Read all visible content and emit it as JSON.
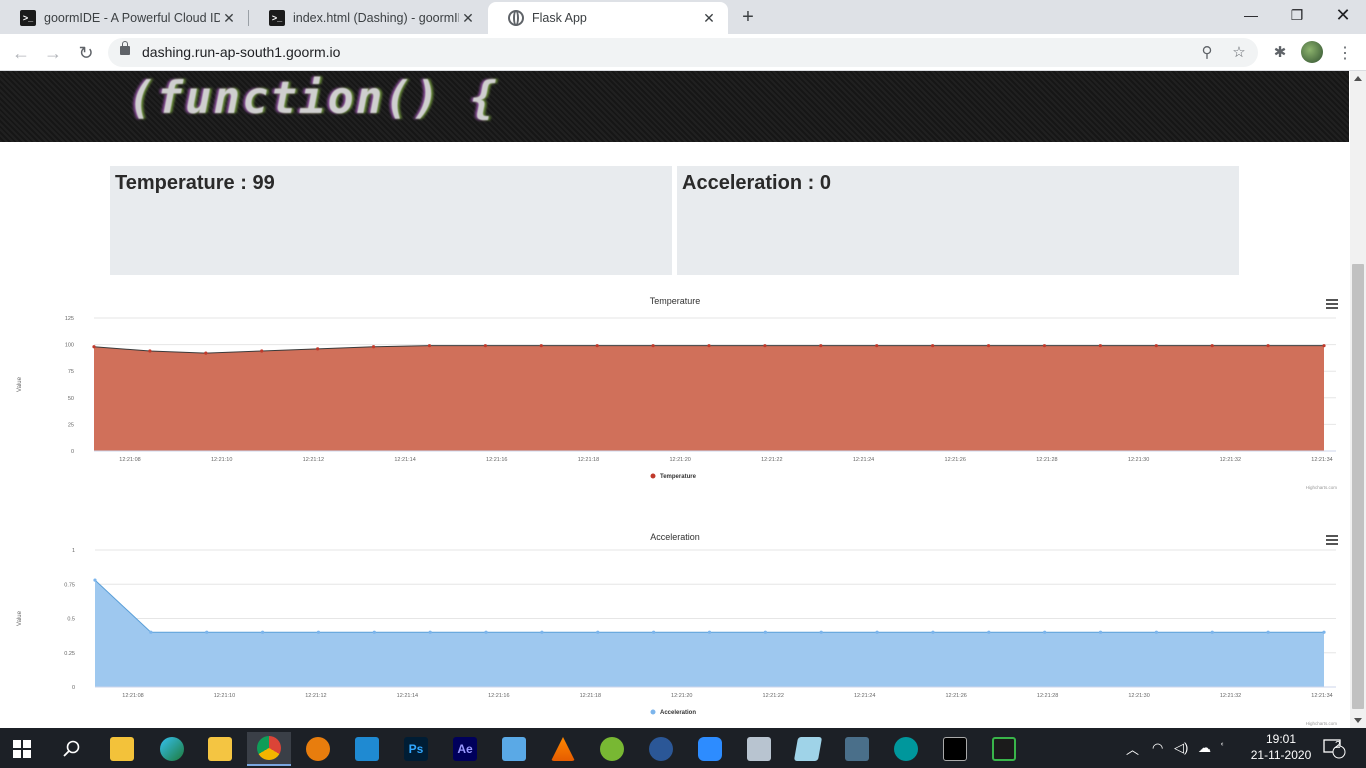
{
  "browser": {
    "tabs": [
      {
        "title": "goormIDE - A Powerful Cloud IDE",
        "icon": "terminal-icon",
        "active": false
      },
      {
        "title": "index.html (Dashing) - goormIDE",
        "icon": "terminal-icon",
        "active": false
      },
      {
        "title": "Flask App",
        "icon": "globe-icon",
        "active": true
      }
    ],
    "url": "dashing.run-ap-south1.goorm.io"
  },
  "banner": {
    "code_text": "(function() {"
  },
  "cards": [
    {
      "label": "Temperature : 99"
    },
    {
      "label": "Acceleration : 0"
    }
  ],
  "chart_data": [
    {
      "type": "area",
      "title": "Temperature",
      "ylabel": "Value",
      "ylim": [
        0,
        125
      ],
      "yticks": [
        0,
        25,
        50,
        75,
        100,
        125
      ],
      "xticks": [
        "12:21:08",
        "12:21:10",
        "12:21:12",
        "12:21:14",
        "12:21:16",
        "12:21:18",
        "12:21:20",
        "12:21:22",
        "12:21:24",
        "12:21:26",
        "12:21:28",
        "12:21:30",
        "12:21:32",
        "12:21:34"
      ],
      "x": [
        0,
        2,
        3.2,
        4.8,
        5.8,
        7.8,
        8.7,
        10.5,
        11.2,
        13.2,
        14.1,
        15.7,
        16.5,
        18.1,
        18.9,
        20.5,
        21.3,
        23.0,
        24.3,
        25.5,
        26.8,
        28.1,
        29.2,
        26.7
      ],
      "values": [
        98,
        94,
        92,
        94,
        96,
        98,
        99,
        99,
        99,
        99,
        99,
        99,
        99,
        99,
        99,
        99,
        99,
        99,
        99,
        99,
        99,
        99,
        99
      ],
      "series": [
        {
          "name": "Temperature",
          "color": "#d0705a",
          "marker_color": "#c0392b"
        }
      ],
      "grid": true,
      "legend": "bottom-center",
      "credits": "Highcharts.com"
    },
    {
      "type": "area",
      "title": "Acceleration",
      "ylabel": "Value",
      "ylim": [
        0,
        1
      ],
      "yticks": [
        0,
        0.25,
        0.5,
        0.75,
        1
      ],
      "xticks": [
        "12:21:08",
        "12:21:10",
        "12:21:12",
        "12:21:14",
        "12:21:16",
        "12:21:18",
        "12:21:20",
        "12:21:22",
        "12:21:24",
        "12:21:26",
        "12:21:28",
        "12:21:30",
        "12:21:32",
        "12:21:34"
      ],
      "values": [
        0.78,
        0.4,
        0.4,
        0.4,
        0.4,
        0.4,
        0.4,
        0.4,
        0.4,
        0.4,
        0.4,
        0.4,
        0.4,
        0.4,
        0.4,
        0.4,
        0.4,
        0.4,
        0.4,
        0.4,
        0.4,
        0.4,
        0.4
      ],
      "series": [
        {
          "name": "Acceleration",
          "color": "#9ec8ef",
          "marker_color": "#7cb5ec"
        }
      ],
      "grid": true,
      "legend": "bottom-center",
      "credits": "Highcharts.com"
    }
  ],
  "taskbar": {
    "apps": [
      "start-icon",
      "search-icon",
      "store-icon",
      "edge-icon",
      "file-explorer-icon",
      "chrome-icon",
      "blender-icon",
      "vscode-icon",
      "photoshop-icon",
      "after-effects-icon",
      "zoom-meeting-icon",
      "vlc-icon",
      "utorrent-icon",
      "media-player-icon",
      "zoom-icon",
      "monitor-icon",
      "notepad-icon",
      "network-tool-icon",
      "arduino-icon",
      "terminal-icon",
      "terminal-green-icon"
    ],
    "ps_label": "Ps",
    "ae_label": "Ae",
    "time": "19:01",
    "date": "21-11-2020",
    "notifications": "2"
  }
}
